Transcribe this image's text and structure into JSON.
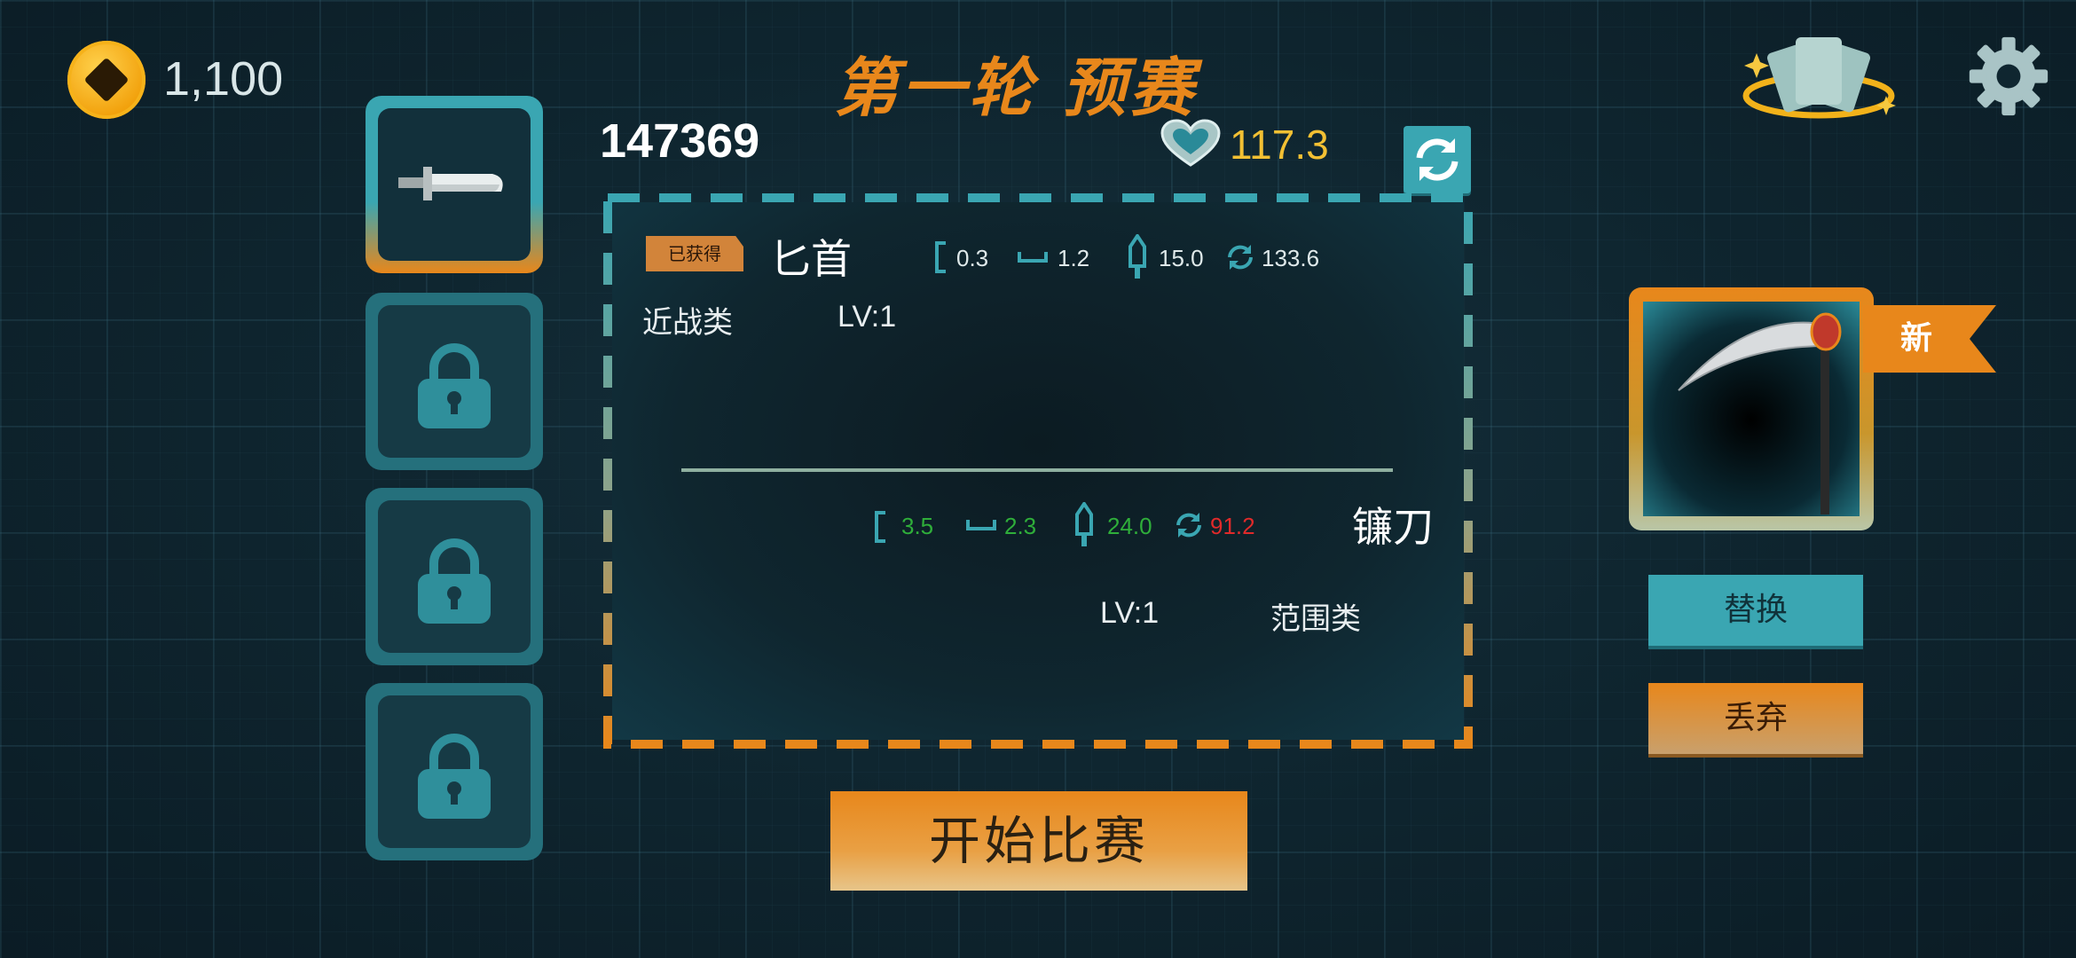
{
  "header": {
    "coins": "1,100",
    "title": "第一轮  预赛"
  },
  "top_bar": {
    "score": "147369",
    "hp": "117.3"
  },
  "current_weapon": {
    "owned_tag": "已获得",
    "name": "匕首",
    "stats": {
      "range": "0.3",
      "width": "1.2",
      "damage": "15.0",
      "speed": "133.6"
    },
    "category": "近战类",
    "level": "LV:1"
  },
  "new_weapon": {
    "name": "镰刀",
    "stats": {
      "range": "3.5",
      "width": "2.3",
      "damage": "24.0",
      "speed": "91.2"
    },
    "level": "LV:1",
    "category": "范围类",
    "badge": "新"
  },
  "buttons": {
    "replace": "替换",
    "discard": "丢弃",
    "start": "开始比赛"
  },
  "colors": {
    "accent_orange": "#e8871b",
    "accent_teal": "#3aa6b2",
    "stat_better": "#2fae3a",
    "stat_worse": "#e02a2a",
    "hp_yellow": "#f3c033"
  },
  "icons": {
    "coin": "coin-icon",
    "settings": "gear-icon",
    "cards": "cards-icon",
    "refresh": "refresh-icon",
    "hp": "heart-icon",
    "lock": "lock-icon"
  }
}
